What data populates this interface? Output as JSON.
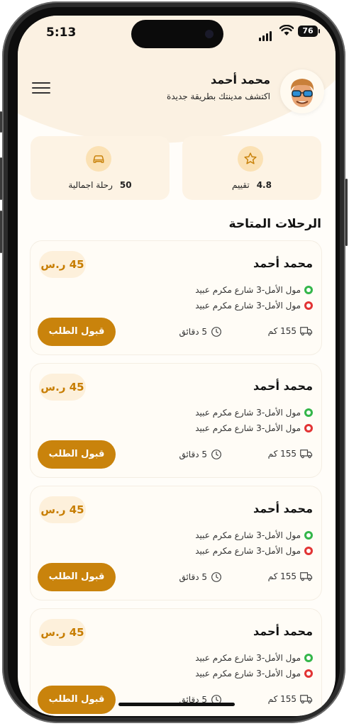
{
  "status": {
    "time": "5:13",
    "battery": "76"
  },
  "header": {
    "name": "محمد أحمد",
    "subtitle": "اكتشف مدينتك بطريقة جديدة"
  },
  "stats": [
    {
      "value": "4.8",
      "label": "تقييم",
      "icon": "star-icon"
    },
    {
      "value": "50",
      "label": "رحلة اجمالية",
      "icon": "car-icon"
    }
  ],
  "section_title": "الرحلات المتاحة",
  "trips": [
    {
      "name": "محمد أحمد",
      "price": "45 ر.س",
      "from": "مول الأمل-3 شارع مكرم عبيد",
      "to": "مول الأمل-3 شارع مكرم عبيد",
      "distance": "155 كم",
      "duration": "5 دقائق",
      "accept": "قبول الطلب"
    },
    {
      "name": "محمد أحمد",
      "price": "45 ر.س",
      "from": "مول الأمل-3 شارع مكرم عبيد",
      "to": "مول الأمل-3 شارع مكرم عبيد",
      "distance": "155 كم",
      "duration": "5 دقائق",
      "accept": "قبول الطلب"
    },
    {
      "name": "محمد أحمد",
      "price": "45 ر.س",
      "from": "مول الأمل-3 شارع مكرم عبيد",
      "to": "مول الأمل-3 شارع مكرم عبيد",
      "distance": "155 كم",
      "duration": "5 دقائق",
      "accept": "قبول الطلب"
    },
    {
      "name": "محمد أحمد",
      "price": "45 ر.س",
      "from": "مول الأمل-3 شارع مكرم عبيد",
      "to": "مول الأمل-3 شارع مكرم عبيد",
      "distance": "155 كم",
      "duration": "5 دقائق",
      "accept": "قبول الطلب"
    }
  ],
  "colors": {
    "accent": "#c9830c",
    "price_bg": "#fdf0db",
    "stat_bg": "#fdf3e4",
    "green": "#34b64a",
    "red": "#e23434"
  }
}
